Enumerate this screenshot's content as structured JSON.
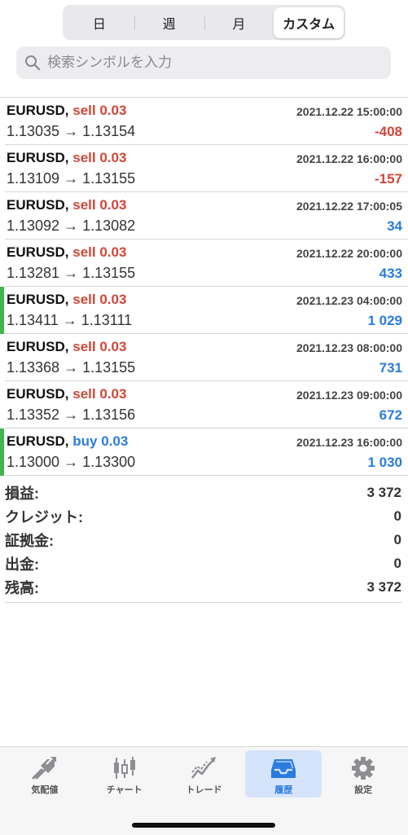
{
  "segments": [
    {
      "label": "日"
    },
    {
      "label": "週"
    },
    {
      "label": "月"
    },
    {
      "label": "カスタム"
    }
  ],
  "search": {
    "placeholder": "検索シンボルを入力"
  },
  "orders": [
    {
      "symbol": "EURUSD,",
      "type": "sell 0.03",
      "side": "sell",
      "time": "2021.12.22 15:00:00",
      "prices": "1.13035 → 1.13154",
      "profit": "-408",
      "marked": false
    },
    {
      "symbol": "EURUSD,",
      "type": "sell 0.03",
      "side": "sell",
      "time": "2021.12.22 16:00:00",
      "prices": "1.13109 → 1.13155",
      "profit": "-157",
      "marked": false
    },
    {
      "symbol": "EURUSD,",
      "type": "sell 0.03",
      "side": "sell",
      "time": "2021.12.22 17:00:05",
      "prices": "1.13092 → 1.13082",
      "profit": "34",
      "marked": false
    },
    {
      "symbol": "EURUSD,",
      "type": "sell 0.03",
      "side": "sell",
      "time": "2021.12.22 20:00:00",
      "prices": "1.13281 → 1.13155",
      "profit": "433",
      "marked": false
    },
    {
      "symbol": "EURUSD,",
      "type": "sell 0.03",
      "side": "sell",
      "time": "2021.12.23 04:00:00",
      "prices": "1.13411 → 1.13111",
      "profit": "1 029",
      "marked": true
    },
    {
      "symbol": "EURUSD,",
      "type": "sell 0.03",
      "side": "sell",
      "time": "2021.12.23 08:00:00",
      "prices": "1.13368 → 1.13155",
      "profit": "731",
      "marked": false
    },
    {
      "symbol": "EURUSD,",
      "type": "sell 0.03",
      "side": "sell",
      "time": "2021.12.23 09:00:00",
      "prices": "1.13352 → 1.13156",
      "profit": "672",
      "marked": false
    },
    {
      "symbol": "EURUSD,",
      "type": "buy 0.03",
      "side": "buy",
      "time": "2021.12.23 16:00:00",
      "prices": "1.13000 → 1.13300",
      "profit": "1 030",
      "marked": true
    }
  ],
  "summary": [
    {
      "label": "損益:",
      "value": "3 372"
    },
    {
      "label": "クレジット:",
      "value": "0"
    },
    {
      "label": "証拠金:",
      "value": "0"
    },
    {
      "label": "出金:",
      "value": "0"
    },
    {
      "label": "残高:",
      "value": "3 372"
    }
  ],
  "tabs": [
    {
      "label": "気配値",
      "icon": "quotes-icon"
    },
    {
      "label": "チャート",
      "icon": "chart-icon"
    },
    {
      "label": "トレード",
      "icon": "trade-icon"
    },
    {
      "label": "履歴",
      "icon": "history-icon"
    },
    {
      "label": "設定",
      "icon": "settings-icon"
    }
  ],
  "colors": {
    "sell": "#d24637",
    "buy": "#2a7cdf",
    "negative": "#d24637",
    "positive": "#2a7cdf",
    "marker": "#3fb54a",
    "active_tab_bg": "#d5e4fb"
  }
}
